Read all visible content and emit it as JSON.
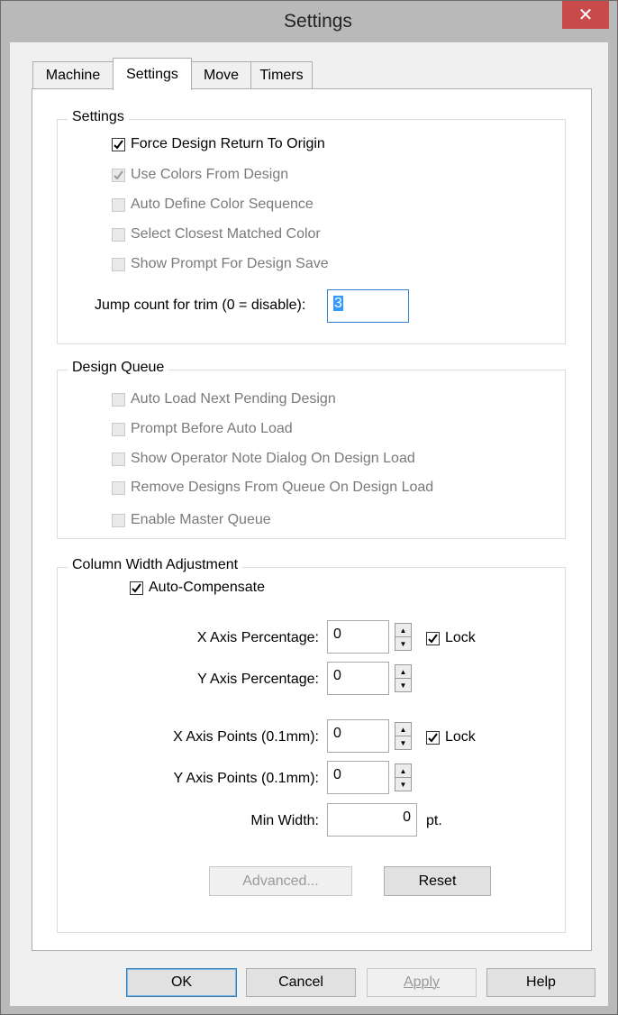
{
  "window": {
    "title": "Settings",
    "close_symbol": "✕"
  },
  "tabs": [
    {
      "label": "Machine"
    },
    {
      "label": "Settings"
    },
    {
      "label": "Move"
    },
    {
      "label": "Timers"
    }
  ],
  "settings_group": {
    "title": "Settings",
    "checkboxes": [
      {
        "label": "Force Design Return To Origin",
        "checked": true,
        "enabled": true
      },
      {
        "label": "Use Colors From Design",
        "checked": true,
        "enabled": false
      },
      {
        "label": "Auto Define Color Sequence",
        "checked": false,
        "enabled": false
      },
      {
        "label": "Select Closest Matched Color",
        "checked": false,
        "enabled": false
      },
      {
        "label": "Show Prompt For Design Save",
        "checked": false,
        "enabled": false
      }
    ],
    "jump_count": {
      "label": "Jump count for trim (0 = disable):",
      "value": "3"
    }
  },
  "queue_group": {
    "title": "Design Queue",
    "checkboxes": [
      {
        "label": "Auto Load Next Pending Design",
        "checked": false,
        "enabled": false
      },
      {
        "label": "Prompt Before Auto Load",
        "checked": false,
        "enabled": false
      },
      {
        "label": "Show Operator Note Dialog On Design Load",
        "checked": false,
        "enabled": false
      },
      {
        "label": "Remove Designs From Queue On Design Load",
        "checked": false,
        "enabled": false
      },
      {
        "label": "Enable Master Queue",
        "checked": false,
        "enabled": false
      }
    ]
  },
  "column_group": {
    "title": "Column Width Adjustment",
    "auto_compensate": {
      "label": "Auto-Compensate",
      "checked": true
    },
    "x_axis_percentage": {
      "label": "X Axis Percentage:",
      "value": "0"
    },
    "y_axis_percentage": {
      "label": "Y Axis Percentage:",
      "value": "0"
    },
    "x_axis_points": {
      "label": "X Axis Points (0.1mm):",
      "value": "0"
    },
    "y_axis_points": {
      "label": "Y Axis Points (0.1mm):",
      "value": "0"
    },
    "lock_label": "Lock",
    "lock1_checked": true,
    "lock2_checked": true,
    "min_width": {
      "label": "Min Width:",
      "value": "0",
      "unit": "pt."
    },
    "advanced_label": "Advanced...",
    "reset_label": "Reset"
  },
  "footer": {
    "ok": "OK",
    "cancel": "Cancel",
    "apply": "Apply",
    "help": "Help"
  },
  "colors": {
    "titlebar": "#b9b9b9",
    "close": "#c94a4a",
    "focus": "#3a80d2"
  }
}
